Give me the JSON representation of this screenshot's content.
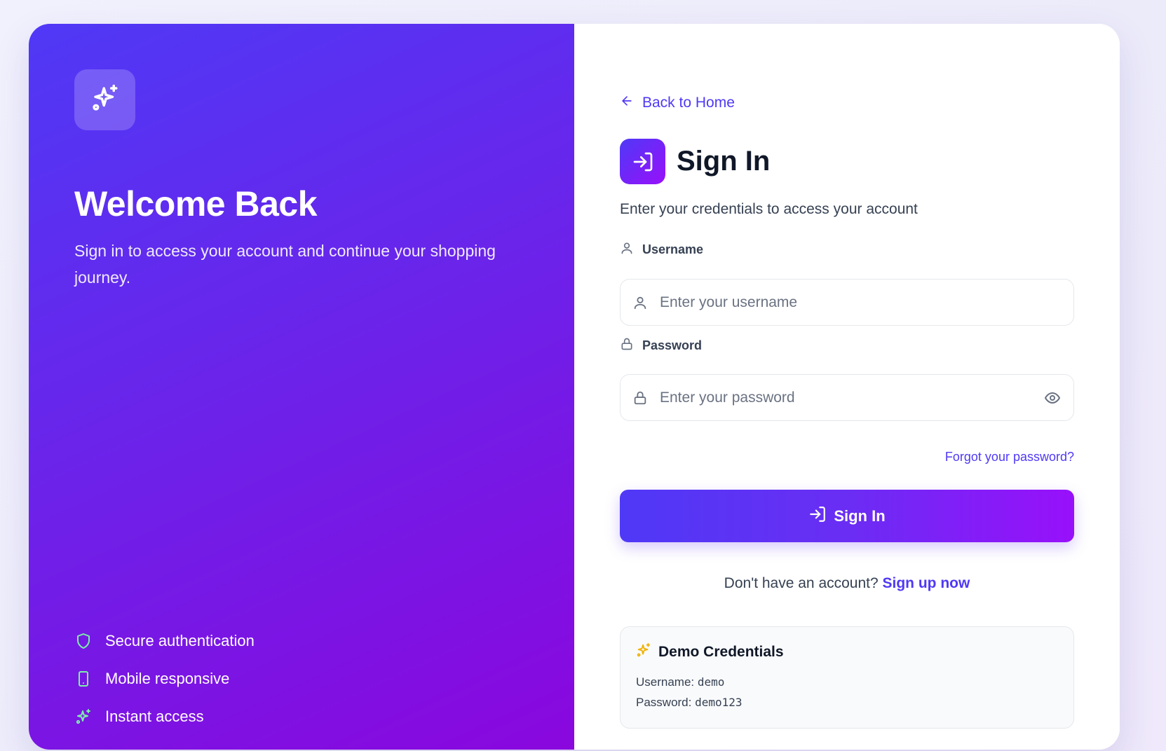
{
  "left_panel": {
    "brand_icon": "sparkles-icon",
    "title": "Welcome Back",
    "subtitle": "Sign in to access your account and continue your shopping journey.",
    "features": [
      {
        "icon": "shield-icon",
        "label": "Secure authentication"
      },
      {
        "icon": "smartphone-icon",
        "label": "Mobile responsive"
      },
      {
        "icon": "sparkles-icon",
        "label": "Instant access"
      }
    ],
    "feature_icon_color": "#7bf1a8"
  },
  "right_panel": {
    "back_link": "Back to Home",
    "title": "Sign In",
    "subtitle": "Enter your credentials to access your account",
    "username": {
      "label": "Username",
      "placeholder": "Enter your username",
      "value": ""
    },
    "password": {
      "label": "Password",
      "placeholder": "Enter your password",
      "value": ""
    },
    "forgot_link": "Forgot your password?",
    "submit_label": "Sign In",
    "signup_prompt": "Don't have an account?",
    "signup_link": "Sign up now",
    "demo": {
      "title": "Demo Credentials",
      "username_label": "Username:",
      "username_value": "demo",
      "password_label": "Password:",
      "password_value": "demo123"
    }
  },
  "colors": {
    "accent": "#4f39f6",
    "accent_end": "#9810fa",
    "demo_icon": "#f0b100"
  }
}
